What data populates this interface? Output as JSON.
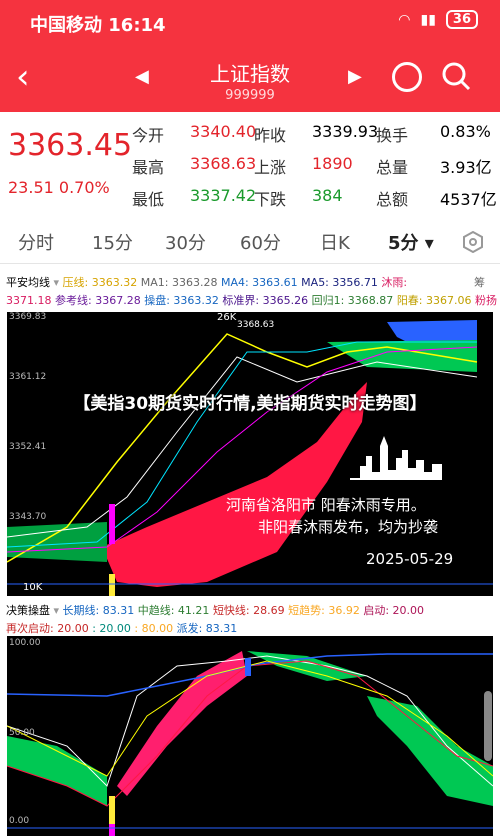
{
  "status": {
    "carrier_time": "中国移动 16:14",
    "battery": "36"
  },
  "nav": {
    "title": "上证指数",
    "code": "999999"
  },
  "quote": {
    "price": "3363.45",
    "change": "23.51 0.70%",
    "cells": [
      {
        "label": "今开",
        "value": "3340.40",
        "cls": "red"
      },
      {
        "label": "昨收",
        "value": "3339.93",
        "cls": ""
      },
      {
        "label": "换手",
        "value": "0.83%",
        "cls": ""
      },
      {
        "label": "最高",
        "value": "3368.63",
        "cls": "red"
      },
      {
        "label": "上涨",
        "value": "1890",
        "cls": "red"
      },
      {
        "label": "总量",
        "value": "3.93亿",
        "cls": ""
      },
      {
        "label": "最低",
        "value": "3337.42",
        "cls": "green"
      },
      {
        "label": "下跌",
        "value": "384",
        "cls": "green"
      },
      {
        "label": "总额",
        "value": "4537亿",
        "cls": ""
      }
    ]
  },
  "tabs": [
    "分时",
    "15分",
    "30分",
    "60分",
    "日K",
    "5分"
  ],
  "indicator1": {
    "name": "平安均线",
    "row1": [
      "压线: 3363.32",
      "MA1: 3363.28",
      "MA4: 3363.61",
      "MA5: 3356.71",
      "沐雨:"
    ],
    "row2": [
      "3371.18",
      "参考线: 3367.28",
      "操盘: 3363.32",
      "标准界: 3365.26",
      "回归1: 3368.87",
      "阳春: 3367.06",
      "粉扬"
    ],
    "right": "筹"
  },
  "chart1": {
    "ylabels": [
      "3369.83",
      "3361.12",
      "3352.41",
      "3343.70"
    ],
    "hi": "26K",
    "hi_val": "3368.63",
    "lo": "10K"
  },
  "watermark": {
    "title": "【美指30期货实时行情,美指期货实时走势图】",
    "loc1": "河南省洛阳市   阳春沐雨专用。",
    "loc2": "非阳春沐雨发布，均为抄袭",
    "date": "2025-05-29"
  },
  "indicator2": {
    "name": "决策操盘",
    "row1": [
      "长期线: 83.31",
      "中趋线: 41.21",
      "短快线: 28.69",
      "短趋势: 36.92",
      "启动: 20.00"
    ],
    "row2": [
      "再次启动: 20.00",
      ": 20.00",
      ": 80.00",
      "派发: 83.31"
    ]
  },
  "chart2": {
    "ylabels": [
      "100.00",
      "50.00",
      "0.00"
    ]
  }
}
